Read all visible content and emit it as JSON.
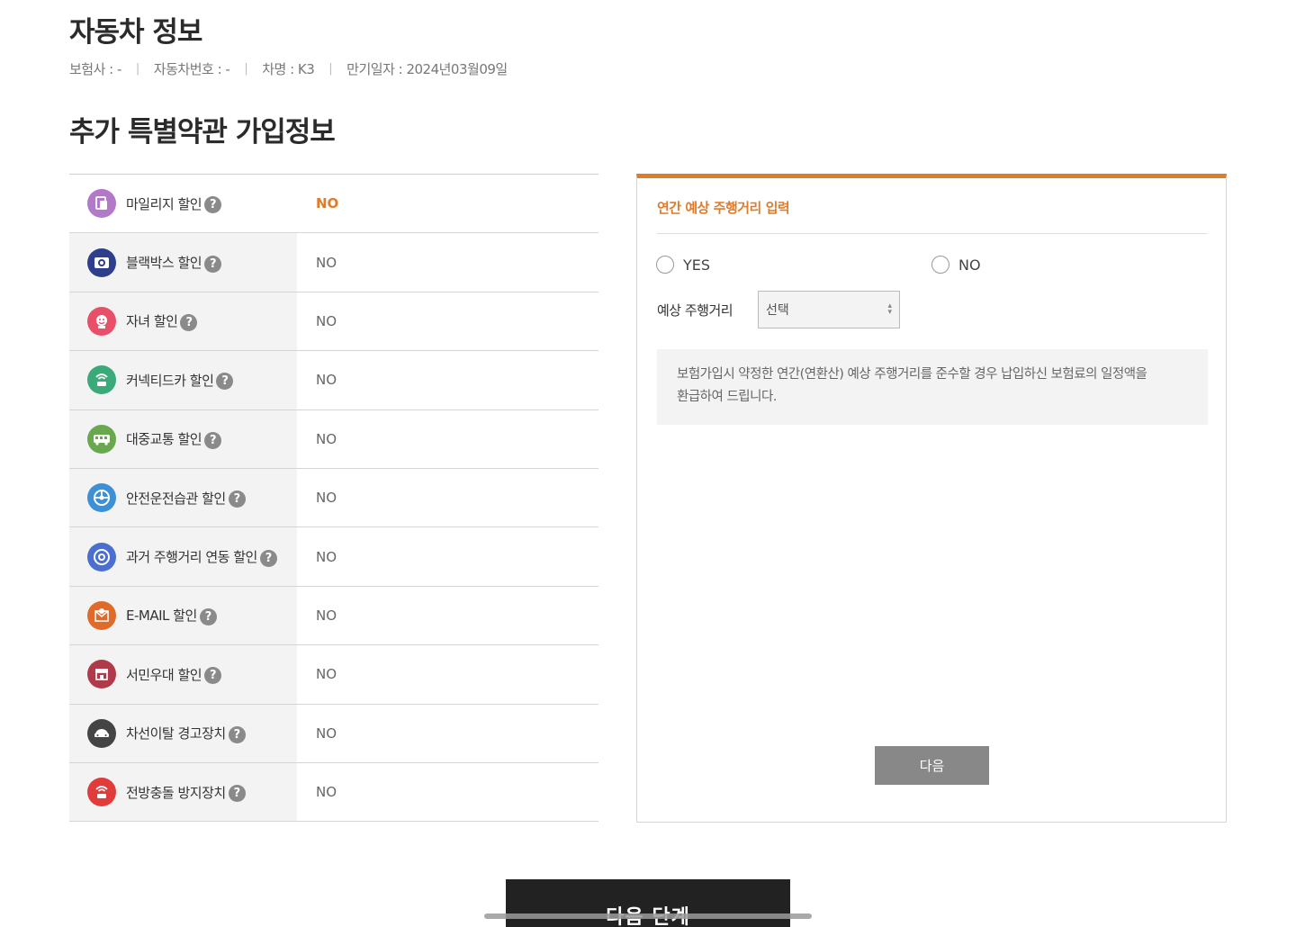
{
  "car_info": {
    "title": "자동차 정보",
    "insurer": "보험사 : -",
    "car_number": "자동차번호 : -",
    "car_name": "차명 : K3",
    "expiry": "만기일자 : 2024년03월09일",
    "separator": "|"
  },
  "section": {
    "title": "추가 특별약관 가입정보"
  },
  "discounts": [
    {
      "label": "마일리지 할인",
      "value": "NO",
      "icon": "mileage-icon",
      "color": "#b279c9",
      "active": true
    },
    {
      "label": "블랙박스 할인",
      "value": "NO",
      "icon": "blackbox-icon",
      "color": "#2c3e8c"
    },
    {
      "label": "자녀 할인",
      "value": "NO",
      "icon": "child-icon",
      "color": "#e8506a"
    },
    {
      "label": "커넥티드카 할인",
      "value": "NO",
      "icon": "connected-car-icon",
      "color": "#3aaa7a"
    },
    {
      "label": "대중교통 할인",
      "value": "NO",
      "icon": "bus-icon",
      "color": "#6aa84f"
    },
    {
      "label": "안전운전습관 할인",
      "value": "NO",
      "icon": "safe-driving-icon",
      "color": "#3d8fd6"
    },
    {
      "label": "과거 주행거리 연동 할인",
      "value": "NO",
      "icon": "odometer-icon",
      "color": "#4a6fd1"
    },
    {
      "label": "E-MAIL 할인",
      "value": "NO",
      "icon": "email-icon",
      "color": "#e06a2a"
    },
    {
      "label": "서민우대 할인",
      "value": "NO",
      "icon": "store-icon",
      "color": "#b03a4a"
    },
    {
      "label": "차선이탈 경고장치",
      "value": "NO",
      "icon": "lane-departure-icon",
      "color": "#444444"
    },
    {
      "label": "전방충돌 방지장치",
      "value": "NO",
      "icon": "collision-icon",
      "color": "#e03c3c"
    }
  ],
  "help_glyph": "?",
  "panel": {
    "title": "연간 예상 주행거리 입력",
    "radio_yes": "YES",
    "radio_no": "NO",
    "distance_label": "예상 주행거리",
    "distance_select": "선택",
    "info_line1": "보험가입시 약정한 연간(연환산) 예상 주행거리를 준수할 경우 납입하신 보험료의 일정액을",
    "info_line2": "환급하여 드립니다.",
    "next_button": "다음"
  },
  "footer": {
    "next_step": "다음 단계"
  },
  "colors": {
    "accent": "#e07b29",
    "dark": "#222222",
    "button_gray": "#888888"
  }
}
